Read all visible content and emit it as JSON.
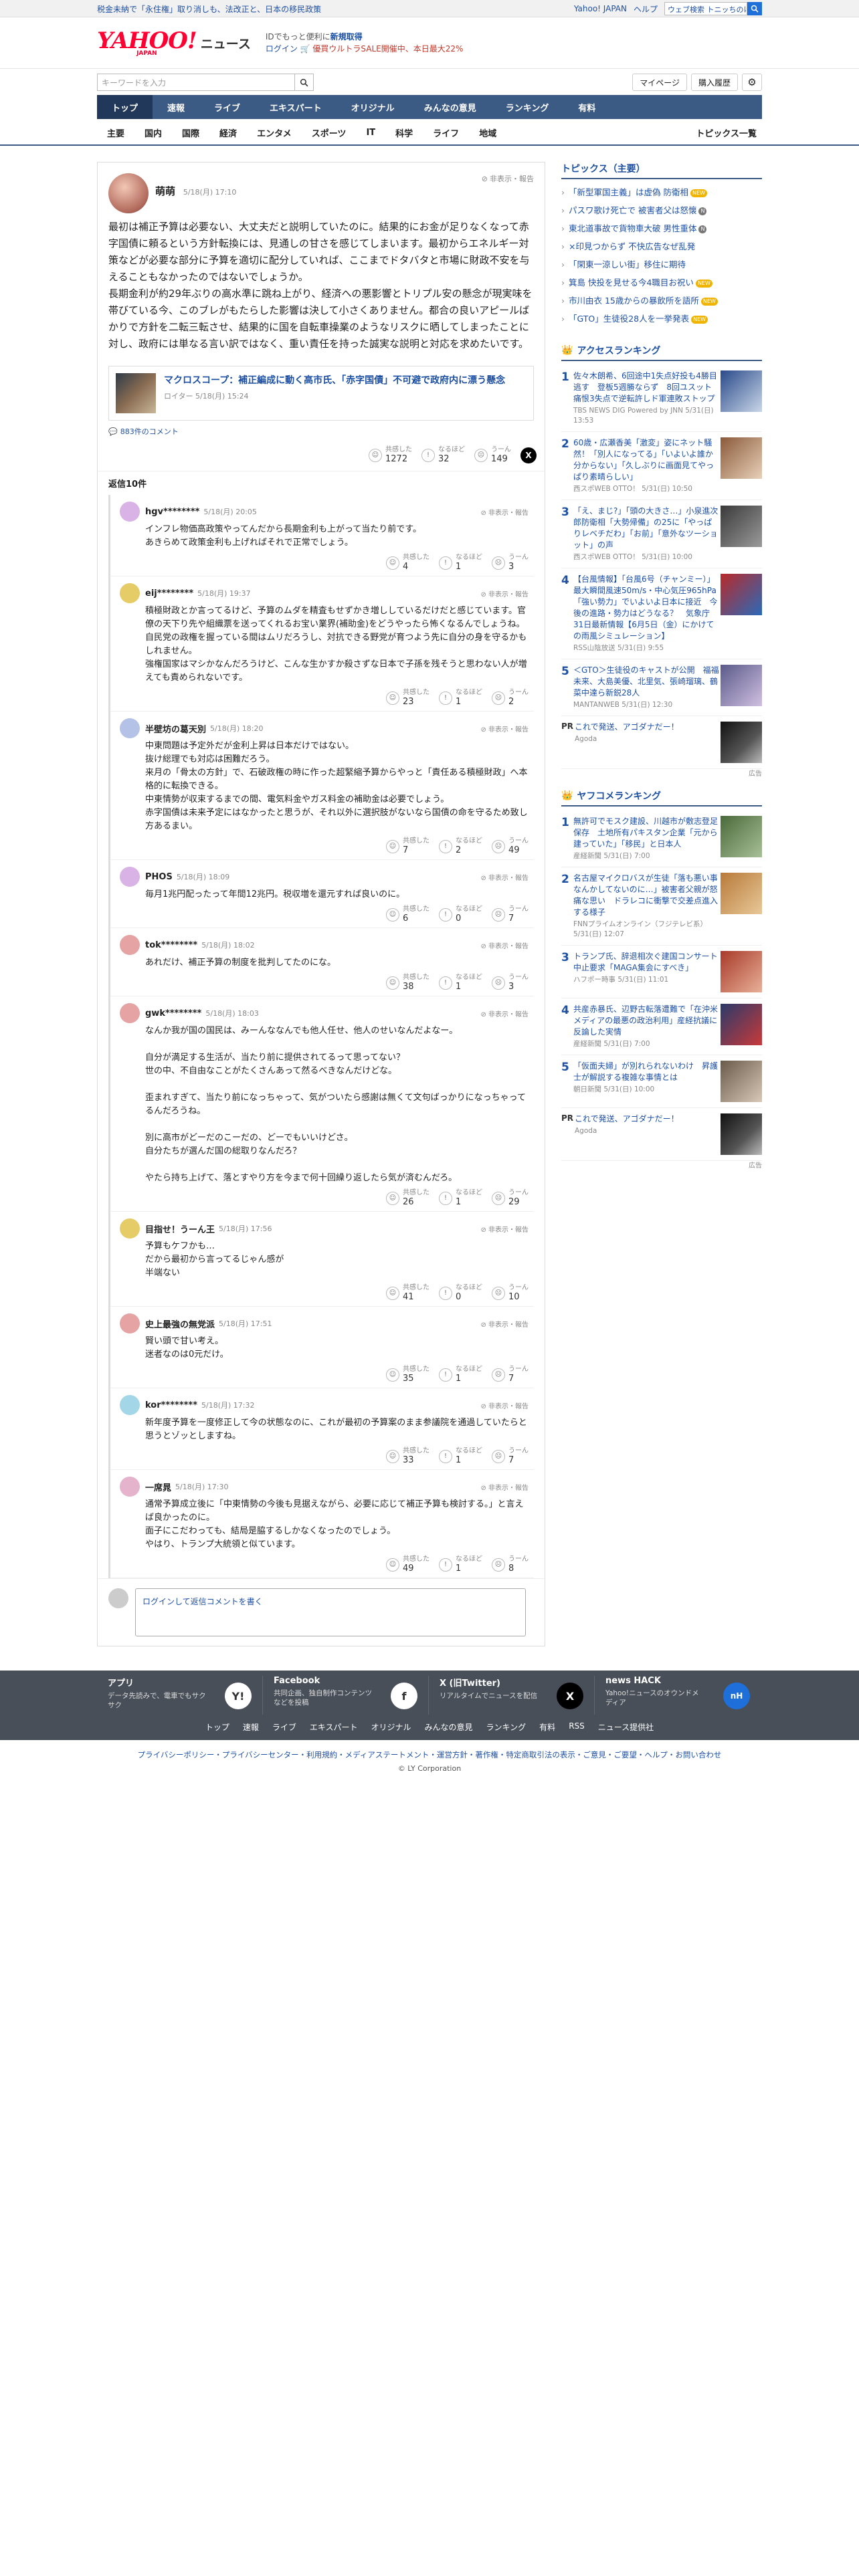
{
  "topbar": {
    "news": "税金未納で「永住権」取り消しも、法改正と、日本の移民政策",
    "home": "Yahoo! JAPAN",
    "help": "ヘルプ",
    "search_placeholder": "ウェブ検索",
    "search_value": "トニッちのけんた"
  },
  "logo": {
    "yahoo": "YAHOO!",
    "japan": "JAPAN",
    "news": "ニュース"
  },
  "promo": {
    "line1a": "IDでもっと便利に",
    "line1b": "新規取得",
    "line2a": "ログイン",
    "line2b": "🛒 優買ウルトラSALE開催中、本日最大22%"
  },
  "search": {
    "placeholder": "キーワードを入力"
  },
  "buttons": {
    "mypage": "マイページ",
    "history": "購入履歴"
  },
  "gnav": [
    "トップ",
    "速報",
    "ライブ",
    "エキスパート",
    "オリジナル",
    "みんなの意見",
    "ランキング",
    "有料"
  ],
  "catnav": {
    "items": [
      "主要",
      "国内",
      "国際",
      "経済",
      "エンタメ",
      "スポーツ",
      "IT",
      "科学",
      "ライフ",
      "地域"
    ],
    "all": "トピックス一覧"
  },
  "comment": {
    "name": "萌萌",
    "time": "5/18(月) 17:10",
    "report": "非表示・報告",
    "paragraphs": [
      "最初は補正予算は必要ない、大丈夫だと説明していたのに。結果的にお金が足りなくなって赤字国債に頼るという方針転換には、見通しの甘さを感じてしまいます。最初からエネルギー対策などが必要な部分に予算を適切に配分していれば、ここまでドタバタと市場に財政不安を与えることもなかったのではないでしょうか。",
      "長期金利が約29年ぶりの高水準に跳ね上がり、経済への悪影響とトリプル安の懸念が現実味を帯びている今、このブレがもたらした影響は決して小さくありません。都合の良いアピールばかりで方針を二転三転させ、結果的に国を自転車操業のようなリスクに晒してしまったことに対し、政府には単なる言い訳ではなく、重い責任を持った誠実な説明と対応を求めたいです。"
    ],
    "article_title": "マクロスコープ：補正編成に動く高市氏、「赤字国債」不可避で政府内に漂う懸念",
    "article_source": "ロイター 5/18(月) 15:24",
    "comment_link": "883件のコメント",
    "reactions": {
      "agree_label": "共感した",
      "agree": "1272",
      "naruhodo_label": "なるほど",
      "naruhodo": "32",
      "uun_label": "うーん",
      "uun": "149"
    },
    "x_label": "X"
  },
  "replies_header": "返信10件",
  "reaction_labels": {
    "agree": "共感した",
    "naruhodo": "なるほど",
    "uun": "うーん"
  },
  "replies": [
    {
      "name": "hgv********",
      "time": "5/18(月) 20:05",
      "color": "#d9b3e6",
      "lines": [
        "インフレ物価高政策やってんだから長期金利も上がって当たり前です。",
        "あきらめて政策金利も上げればそれで正常でしょう。"
      ],
      "agree": "4",
      "naruhodo": "1",
      "uun": "3"
    },
    {
      "name": "eij********",
      "time": "5/18(月) 19:37",
      "color": "#e6cc66",
      "lines": [
        "積極財政とか言ってるけど、予算のムダを精査もせずかき増ししているだけだと感じています。官僚の天下り先や組織票を送ってくれるお宝い業界(補助金)をどうやったら怖くなるんでしょうね。自民党の政権を握っている間はムリだろうし、対抗できる野党が育つよう先に自分の身を守るかもしれません。",
        "強権国家はマシかなんだろうけど、こんな生かすか殺さずな日本で子孫を残そうと思わない人が増えても責められないです。"
      ],
      "agree": "23",
      "naruhodo": "1",
      "uun": "2"
    },
    {
      "name": "半壁坊の葛天別",
      "time": "5/18(月) 18:20",
      "color": "#b3c2e6",
      "lines": [
        "中東問題は予定外だが金利上昇は日本だけではない。",
        "抜け総理でも対応は困難だろう。",
        "来月の「骨太の方針」で、石破政権の時に作った超緊縮予算からやっと「責任ある積極財政」へ本格的に転換できる。",
        "中東情勢が収束するまでの間、電気料金やガス料金の補助金は必要でしょう。",
        "赤字国債は未来予定にはなかったと思うが、それ以外に選択肢がないなら国債の命を守るため致し方あるまい。"
      ],
      "agree": "7",
      "naruhodo": "2",
      "uun": "49"
    },
    {
      "name": "PHOS",
      "time": "5/18(月) 18:09",
      "color": "#d9b3e6",
      "lines": [
        "毎月1兆円配ったって年間12兆円。税収増を還元すれば良いのに。"
      ],
      "agree": "6",
      "naruhodo": "0",
      "uun": "7"
    },
    {
      "name": "tok********",
      "time": "5/18(月) 18:02",
      "color": "#e6a3a3",
      "lines": [
        "あれだけ、補正予算の制度を批判してたのにな。"
      ],
      "agree": "38",
      "naruhodo": "1",
      "uun": "3"
    },
    {
      "name": "gwk********",
      "time": "5/18(月) 18:03",
      "color": "#e6a3a3",
      "lines": [
        "なんか我が国の国民は、みーんななんでも他人任せ、他人のせいなんだよなー。",
        "",
        "自分が満足する生活が、当たり前に提供されてるって思ってない？",
        "世の中、不自由なことがたくさんあって然るべきなんだけどな。",
        "",
        "歪まれすぎて、当たり前になっちゃって、気がついたら感謝は無くて文句ばっかりになっちゃってるんだろうね。",
        "",
        "別に高市がどーだのこーだの、どーでもいいけどさ。",
        "自分たちが選んだ国の総取りなんだろ？",
        "",
        "やたら持ち上げて、落とすやり方を今まで何十回繰り返したら気が済むんだろ。"
      ],
      "agree": "26",
      "naruhodo": "1",
      "uun": "29"
    },
    {
      "name": "目指せ！うーん王",
      "time": "5/18(月) 17:56",
      "color": "#e6cc66",
      "lines": [
        "予算もケフかも…",
        "だから最初から言ってるじゃん感が",
        "半端ない"
      ],
      "agree": "41",
      "naruhodo": "0",
      "uun": "10"
    },
    {
      "name": "史上最強の無党派",
      "time": "5/18(月) 17:51",
      "color": "#e6a3a3",
      "lines": [
        "賢い頭で甘い考え。",
        "迷者なのは0元だけ。"
      ],
      "agree": "35",
      "naruhodo": "1",
      "uun": "7"
    },
    {
      "name": "kor********",
      "time": "5/18(月) 17:32",
      "color": "#a3d6e6",
      "lines": [
        "新年度予算を一度修正して今の状態なのに、これが最初の予算案のまま参議院を通過していたらと思うとゾッとしますね。"
      ],
      "agree": "33",
      "naruhodo": "1",
      "uun": "7"
    },
    {
      "name": "一席晁",
      "time": "5/18(月) 17:30",
      "color": "#e6b3cc",
      "lines": [
        "通常予算成立後に「中東情勢の今後も見据えながら、必要に応じて補正予算も検討する。」と言えば良かったのに。",
        "面子にこだわっても、結局是脇するしかなくなったのでしょう。",
        "やはり、トランプ大統領と似ています。"
      ],
      "agree": "49",
      "naruhodo": "1",
      "uun": "8"
    }
  ],
  "compose": {
    "placeholder": "ログインして返信コメントを書く"
  },
  "side": {
    "topics_title": "トピックス（主要）",
    "topics": [
      {
        "text": "「新型軍国主義」は虚偽 防衛相",
        "tag": "NEW",
        "tagcolor": "#f0b400"
      },
      {
        "text": "パスワ歌け死亡で 被害者父は怒懐",
        "tag": "N",
        "tagcolor": "#777"
      },
      {
        "text": "東北道事故で貨物車大破 男性重体",
        "tag": "N",
        "tagcolor": "#777"
      },
      {
        "text": "×印見つからず 不快広告なぜ乱発",
        "tag": "",
        "tagcolor": ""
      },
      {
        "text": "「閑東一涼しい街」移住に期待",
        "tag": "",
        "tagcolor": ""
      },
      {
        "text": "箕島 快投を見せる今4職目お祝い",
        "tag": "NEW",
        "tagcolor": "#f0b400"
      },
      {
        "text": "市川由衣 15歳からの暴飲所を語所",
        "tag": "NEW",
        "tagcolor": "#f0b400"
      },
      {
        "text": "「GTO」生徒役28人を一挙発表",
        "tag": "NEW",
        "tagcolor": "#f0b400"
      }
    ],
    "access_title": "アクセスランキング",
    "access": [
      {
        "rank": "1",
        "title": "佐々木朗希、6回途中1失点好投も4勝目逃す　登板5週勝ならず　8回ユスット痛恨3失点で逆転許しド軍連敗ストップ",
        "src": "TBS NEWS DIG Powered by JNN 5/31(日) 13:53",
        "c1": "#2a4a8a",
        "c2": "#c9d6e8"
      },
      {
        "rank": "2",
        "title": "60歳・広瀬香美「激変」姿にネット騒然！「別人になってる」「いよいよ誰か分からない」「久しぶりに画面見てやっぱり素晴らしい」",
        "src": "西スポWEB OTTO！ 5/31(日) 10:50",
        "c1": "#8a5a3a",
        "c2": "#e8d0b8"
      },
      {
        "rank": "3",
        "title": "「え、まじ?」「頭の大きさ…」小泉進次郎防衛相「大勢帰備」の25に「やっぱりレベチだわ」「お前」「意外なツーショット」の声",
        "src": "西スポWEB OTTO！ 5/31(日) 10:00",
        "c1": "#3a3a3a",
        "c2": "#9a9a9a"
      },
      {
        "rank": "4",
        "title": "【台風情報】「台風6号（チャンミー）」最大瞬間風速50m/s・中心気圧965hPa「強い勢力」でいよいよ日本に接近　今後の進路・勢力はどうなる？　気象庁31日最新情報【6月5日（金）にかけての雨風シミュレーション】",
        "src": "RSS山陰放送 5/31(日) 9:55",
        "c1": "#b82a2a",
        "c2": "#2a6ab8"
      },
      {
        "rank": "5",
        "title": "＜GTO＞生徒役のキャストが公開　福福未来、大島美優、北里気、張崎瑠璃、鶴菜中達ら新鋭28人",
        "src": "MANTANWEB 5/31(日) 12:30",
        "c1": "#5a5a8a",
        "c2": "#d0c0e0"
      }
    ],
    "pr1": {
      "label": "PR",
      "title": "これで発送、アゴダナだー！",
      "src": "Agoda",
      "ad": "広告"
    },
    "yafuco_title": "ヤフコメランキング",
    "yafuco": [
      {
        "rank": "1",
        "title": "無許可でモスク建設、川越市が敷志登足保存　土地所有パキスタン企業「元から建っていた」「移民」と日本人",
        "src": "産経新聞 5/31(日) 7:00",
        "c1": "#4a6a3a",
        "c2": "#a8c098"
      },
      {
        "rank": "2",
        "title": "名古屋マイクロバスが生徒「落も悪い事なんかしてないのに…」被害者父親が怒痛な思い　ドラレコに衝撃で交差点進入する様子",
        "src": "FNNプライムオンライン（フジテレビ系） 5/31(日) 12:07",
        "c1": "#b87a3a",
        "c2": "#e8c898"
      },
      {
        "rank": "3",
        "title": "トランプ氏、辞退相次ぐ建国コンサート中止要求「MAGA集会にすべき」",
        "src": "ハフポー時事 5/31(日) 11:01",
        "c1": "#a83a2a",
        "c2": "#e8b098"
      },
      {
        "rank": "4",
        "title": "共産赤暴氏、辺野古転落遭難で「在沖米メディアの最悪の政治利用」産経抗議に反論した実情",
        "src": "産経新聞 5/31(日) 7:00",
        "c1": "#2a3a6a",
        "c2": "#c83a3a"
      },
      {
        "rank": "5",
        "title": "「仮面夫婦」が別れられないわけ　昇護士が解説する複雑な事情とは",
        "src": "朝日新聞 5/31(日) 10:00",
        "c1": "#6a5a4a",
        "c2": "#d8c8b8"
      }
    ],
    "pr2": {
      "label": "PR",
      "title": "これで発送、アゴダナだー！",
      "src": "Agoda",
      "ad": "広告"
    }
  },
  "footer": {
    "cols": [
      {
        "title": "アプリ",
        "desc": "データ先読みで、電車でもサクサク",
        "icon": "Y!"
      },
      {
        "title": "Facebook",
        "desc": "共同企画、独自制作コンテンツなどを投稿",
        "icon": "f"
      },
      {
        "title": "X (旧Twitter)",
        "desc": "リアルタイムでニュースを配信",
        "icon": "X"
      },
      {
        "title": "news HACK",
        "desc": "Yahoo!ニュースのオウンドメディア",
        "icon": "nH"
      }
    ],
    "links": [
      "トップ",
      "速報",
      "ライブ",
      "エキスパート",
      "オリジナル",
      "みんなの意見",
      "ランキング",
      "有料",
      "RSS",
      "ニュース提供社"
    ],
    "bottom": "プライバシーポリシー・プライバシーセンター・利用規約・メディアステートメント・運営方針・著作権・特定商取引法の表示・ご意見・ご要望・ヘルプ・お問い合わせ",
    "copyright": "© LY Corporation"
  },
  "colors": {
    "nav": "#3b5a84",
    "link": "#1e50a2",
    "brand": "#ff0033"
  }
}
